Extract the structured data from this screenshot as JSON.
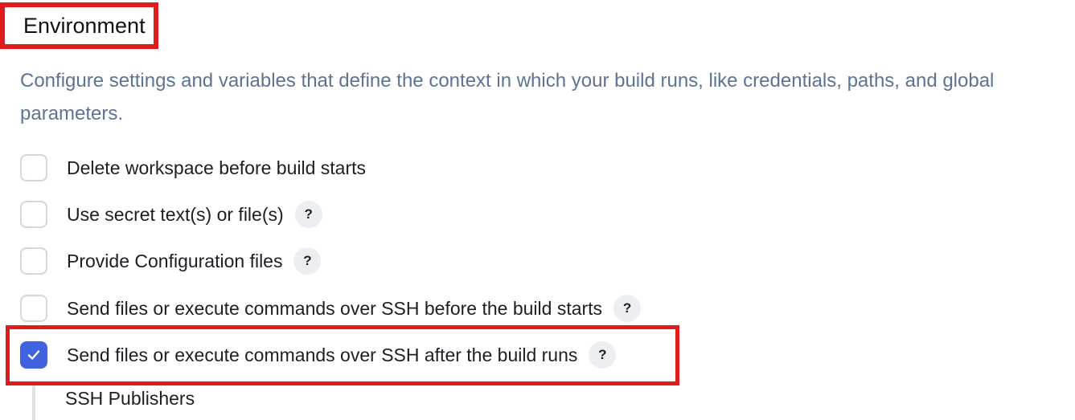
{
  "section": {
    "title": "Environment",
    "description": "Configure settings and variables that define the context in which your build runs, like credentials, paths, and global parameters."
  },
  "options": [
    {
      "label": "Delete workspace before build starts",
      "checked": false,
      "has_help": false
    },
    {
      "label": "Use secret text(s) or file(s)",
      "checked": false,
      "has_help": true,
      "help": "?"
    },
    {
      "label": "Provide Configuration files",
      "checked": false,
      "has_help": true,
      "help": "?"
    },
    {
      "label": "Send files or execute commands over SSH before the build starts",
      "checked": false,
      "has_help": true,
      "help": "?"
    },
    {
      "label": "Send files or execute commands over SSH after the build runs",
      "checked": true,
      "has_help": true,
      "help": "?"
    }
  ],
  "nested": {
    "label": "SSH Publishers"
  },
  "colors": {
    "highlight": "#e01b1b",
    "accent": "#4263e0",
    "description_text": "#5d7394"
  },
  "icons": {
    "checkmark": "check-icon",
    "help": "question-mark-icon"
  }
}
